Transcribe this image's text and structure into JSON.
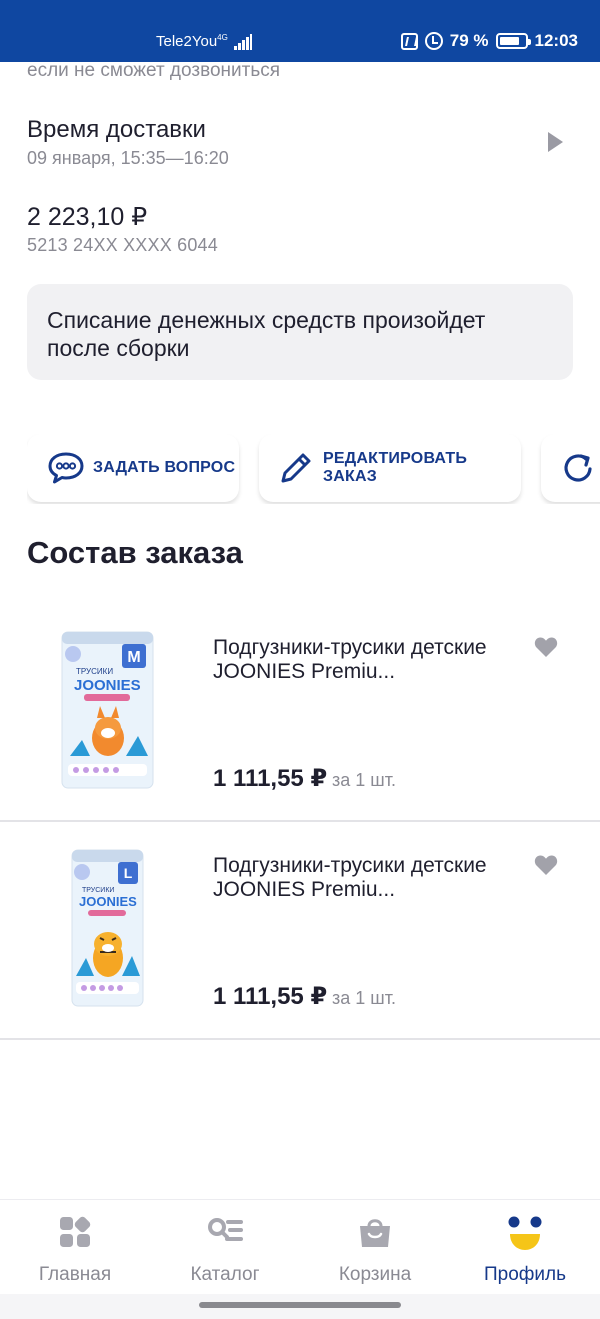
{
  "status_bar": {
    "carrier": "Tele2You",
    "network": "4G",
    "battery": "79 %",
    "battery_level": 0.79,
    "time": "12:03"
  },
  "colors": {
    "status_bar": "#0f47a1",
    "accent": "#16398a",
    "muted": "#8a8a93",
    "notice_bg": "#f1f1f3",
    "brand_yellow": "#f5c518"
  },
  "order": {
    "cut_text": "если не сможет дозвониться",
    "delivery_title": "Время доставки",
    "delivery_time": "09 января, 15:35—16:20",
    "amount": "2 223,10 ₽",
    "card_number": "5213 24XX XXXX 6044",
    "notice": "Списание денежных средств произойдет после сборки"
  },
  "actions": [
    {
      "label": "ЗАДАТЬ ВОПРОС",
      "icon": "chat-bubble-icon"
    },
    {
      "label": "РЕДАКТИРОВАТЬ ЗАКАЗ",
      "icon": "pencil-icon"
    },
    {
      "label": "",
      "icon": "refresh-icon"
    }
  ],
  "section_title": "Состав заказа",
  "products": [
    {
      "name": "Подгузники-трусики детские JOONIES Premiu...",
      "price": "1 111,55 ₽",
      "unit": "за 1 шт.",
      "size": "M",
      "icon": "heart-icon"
    },
    {
      "name": "Подгузники-трусики детские JOONIES Premiu...",
      "price": "1 111,55 ₽",
      "unit": "за 1 шт.",
      "size": "L",
      "icon": "heart-icon"
    }
  ],
  "bottom_nav": [
    {
      "label": "Главная",
      "icon": "grid-icon"
    },
    {
      "label": "Каталог",
      "icon": "catalog-search-icon"
    },
    {
      "label": "Корзина",
      "icon": "bag-icon"
    },
    {
      "label": "Профиль",
      "icon": "smile-face-icon",
      "active": true
    }
  ]
}
